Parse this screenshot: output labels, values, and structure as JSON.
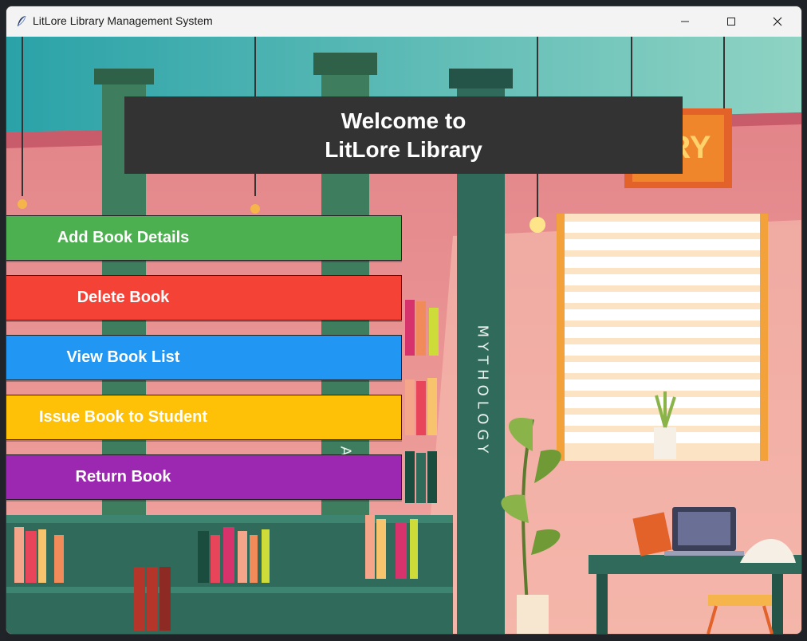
{
  "window": {
    "title": "LitLore Library Management System",
    "controls": {
      "minimize": "minimize-icon",
      "maximize": "maximize-icon",
      "close": "close-icon"
    }
  },
  "banner": {
    "line1": "Welcome to",
    "line2": "LitLore Library"
  },
  "menu": {
    "add_book": "Add Book Details",
    "delete_book": "Delete Book",
    "view_books": "View Book List",
    "issue_book": "Issue Book to Student",
    "return_book": "Return Book"
  },
  "background": {
    "sign_text": "ARY",
    "shelf_label_left": "ASY",
    "shelf_label_right": "MYTHOLOGY"
  },
  "colors": {
    "add": "#4caf50",
    "delete": "#f44336",
    "view": "#2196f3",
    "issue": "#ffc107",
    "return": "#9c27b0",
    "banner": "#333333"
  }
}
